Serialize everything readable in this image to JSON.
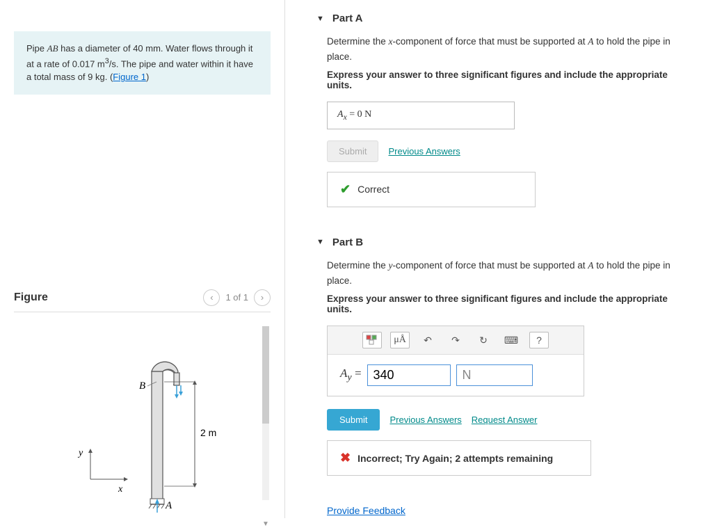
{
  "problem": {
    "text_full": "Pipe AB has a diameter of 40 mm. Water flows through it at a rate of 0.017 m³/s. The pipe and water within it have a total mass of 9 kg. (Figure 1)",
    "figure_link": "Figure 1"
  },
  "figure": {
    "title": "Figure",
    "nav_label": "1 of 1",
    "labels": {
      "A": "A",
      "B": "B",
      "x": "x",
      "y": "y",
      "dim": "2 m"
    }
  },
  "partA": {
    "title": "Part A",
    "prompt_html": "Determine the x-component of force that must be supported at A to hold the pipe in place.",
    "prompt_bold": "Express your answer to three significant figures and include the appropriate units.",
    "answer_display": "Aₓ = 0 N",
    "submit_label": "Submit",
    "prev_label": "Previous Answers",
    "feedback": "Correct"
  },
  "partB": {
    "title": "Part B",
    "prompt_html": "Determine the y-component of force that must be supported at A to hold the pipe in place.",
    "prompt_bold": "Express your answer to three significant figures and include the appropriate units.",
    "var_label": "A_y =",
    "value": "340",
    "unit": "N",
    "submit_label": "Submit",
    "prev_label": "Previous Answers",
    "request_label": "Request Answer",
    "feedback": "Incorrect; Try Again; 2 attempts remaining"
  },
  "provide_feedback": "Provide Feedback",
  "toolbar_help": "?"
}
